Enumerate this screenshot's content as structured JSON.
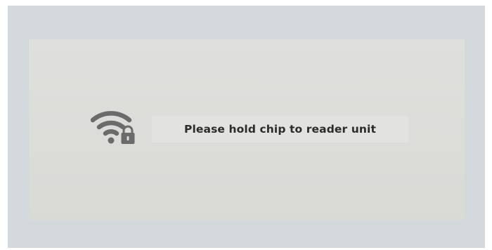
{
  "prompt": {
    "message": "Please hold chip to reader unit",
    "icon": "wifi-lock-icon"
  },
  "colors": {
    "outer_frame": "#d3d8dc",
    "panel": "#dcdcd9",
    "icon": "#6b6b6b",
    "text": "#2b2b2b"
  }
}
